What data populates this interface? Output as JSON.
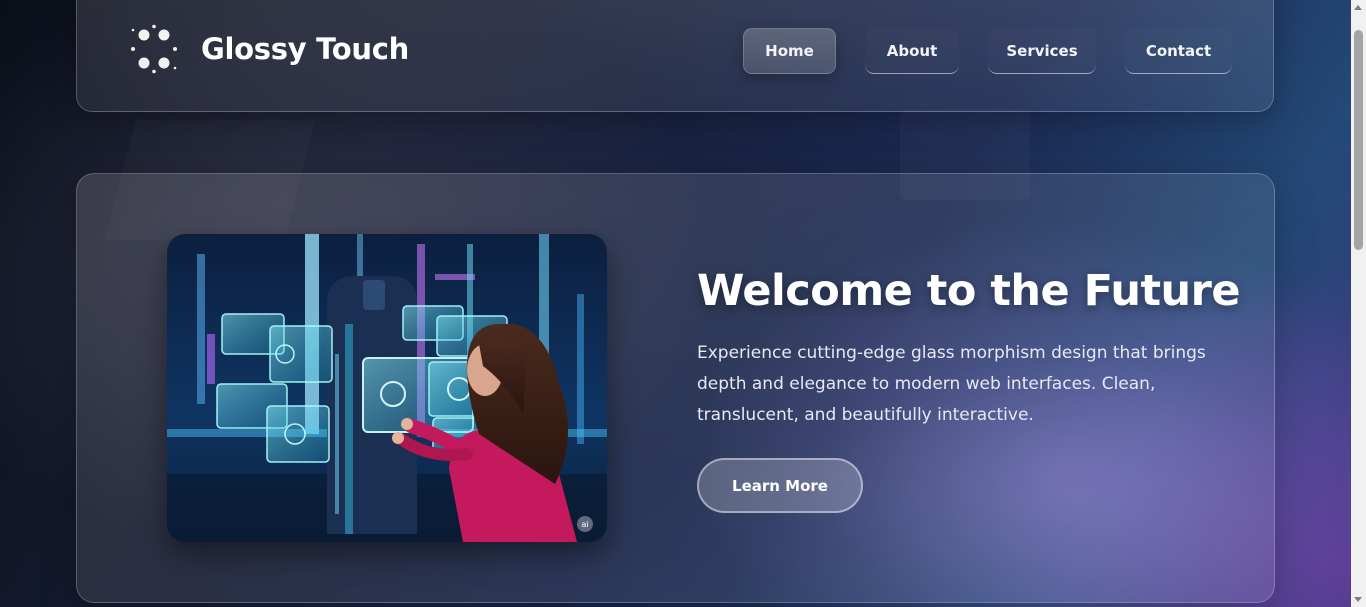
{
  "header": {
    "brand_name": "Glossy Touch",
    "logo_icon": "dots-circle-icon",
    "nav": [
      {
        "label": "Home",
        "active": true
      },
      {
        "label": "About",
        "active": false
      },
      {
        "label": "Services",
        "active": false
      },
      {
        "label": "Contact",
        "active": false
      }
    ]
  },
  "hero": {
    "title": "Welcome to the Future",
    "description": "Experience cutting-edge glass morphism design that brings depth and elegance to modern web interfaces. Clean, translucent, and beautifully interactive.",
    "cta_label": "Learn More",
    "image_badge": "ai"
  },
  "colors": {
    "background_dark": "#0b0f19",
    "background_blue": "#244877",
    "accent_purple": "#7a4fb0",
    "text": "#ffffff"
  }
}
